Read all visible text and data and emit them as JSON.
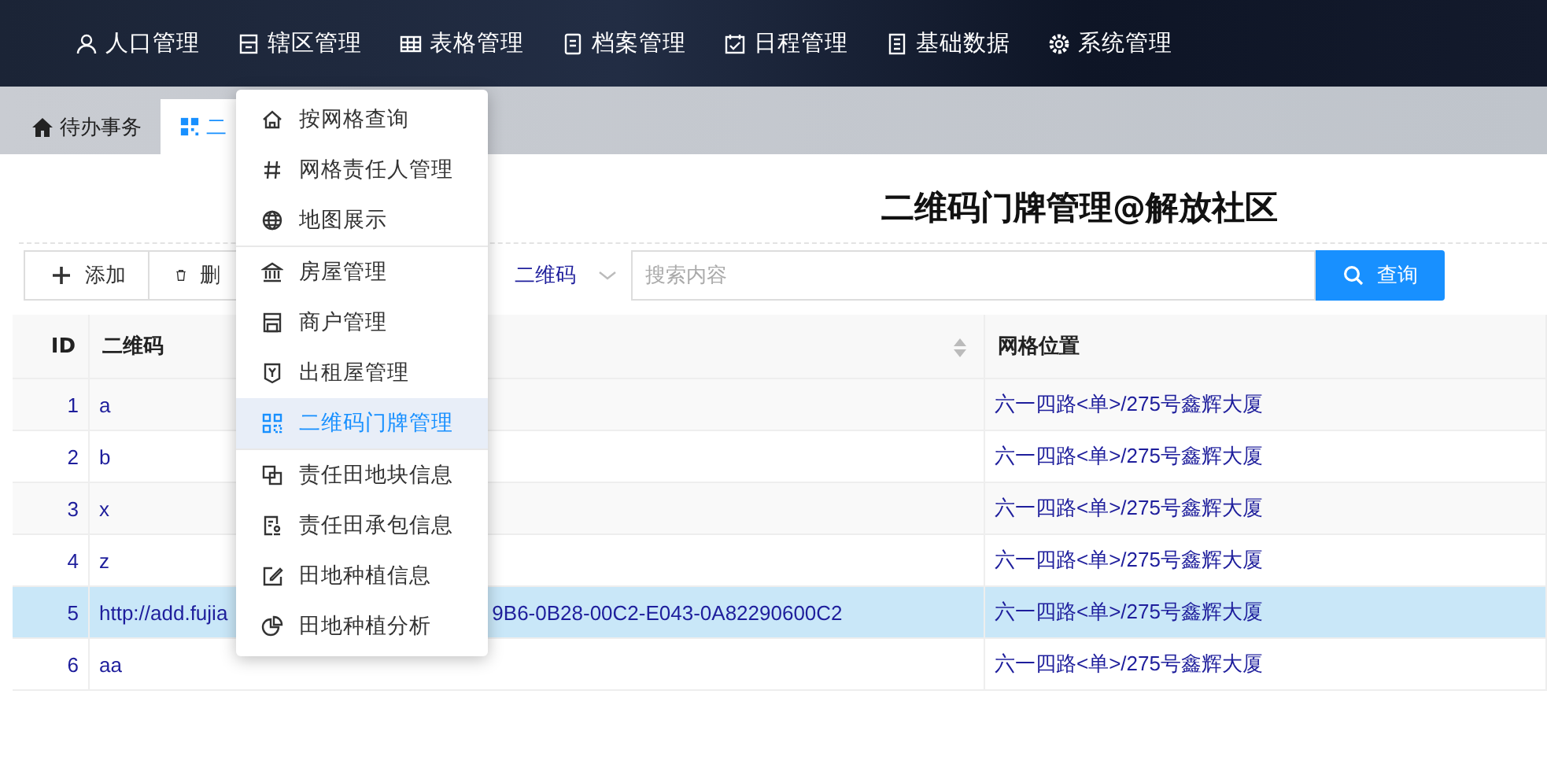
{
  "nav": {
    "items": [
      {
        "label": "人口管理"
      },
      {
        "label": "辖区管理"
      },
      {
        "label": "表格管理"
      },
      {
        "label": "档案管理"
      },
      {
        "label": "日程管理"
      },
      {
        "label": "基础数据"
      },
      {
        "label": "系统管理"
      }
    ]
  },
  "tabs": [
    {
      "label": "待办事务",
      "selected": false
    },
    {
      "label": "二",
      "selected": true
    }
  ],
  "dropdown_menu": {
    "groups": [
      [
        {
          "label": "按网格查询",
          "selected": false
        },
        {
          "label": "网格责任人管理",
          "selected": false
        },
        {
          "label": "地图展示",
          "selected": false
        }
      ],
      [
        {
          "label": "房屋管理",
          "selected": false
        },
        {
          "label": "商户管理",
          "selected": false
        },
        {
          "label": "出租屋管理",
          "selected": false
        },
        {
          "label": "二维码门牌管理",
          "selected": true
        }
      ],
      [
        {
          "label": "责任田地块信息",
          "selected": false
        },
        {
          "label": "责任田承包信息",
          "selected": false
        },
        {
          "label": "田地种植信息",
          "selected": false
        },
        {
          "label": "田地种植分析",
          "selected": false
        }
      ]
    ]
  },
  "page_title": "二维码门牌管理@解放社区",
  "toolbar": {
    "buttons": [
      "添加",
      "删"
    ],
    "search_field": "二维码",
    "search": {
      "placeholder": "搜索内容"
    },
    "query_button": "查询"
  },
  "table": {
    "columns": [
      "ID",
      "二维码",
      "网格位置"
    ],
    "rows": [
      {
        "id": "1",
        "qr": [
          "a"
        ],
        "location": "六一四路<单>/275号鑫辉大厦",
        "selected": false
      },
      {
        "id": "2",
        "qr": [
          "b"
        ],
        "location": "六一四路<单>/275号鑫辉大厦",
        "selected": false
      },
      {
        "id": "3",
        "qr": [
          "x"
        ],
        "location": "六一四路<单>/275号鑫辉大厦",
        "selected": false
      },
      {
        "id": "4",
        "qr": [
          "z"
        ],
        "location": "六一四路<单>/275号鑫辉大厦",
        "selected": false
      },
      {
        "id": "5",
        "qr": [
          "http://add.fujia",
          "9B6-0B28-00C2-E043-0A82290600C2"
        ],
        "location": "六一四路<单>/275号鑫辉大厦",
        "selected": true
      },
      {
        "id": "6",
        "qr": [
          "aa"
        ],
        "location": "六一四路<单>/275号鑫辉大厦",
        "selected": false
      }
    ]
  }
}
